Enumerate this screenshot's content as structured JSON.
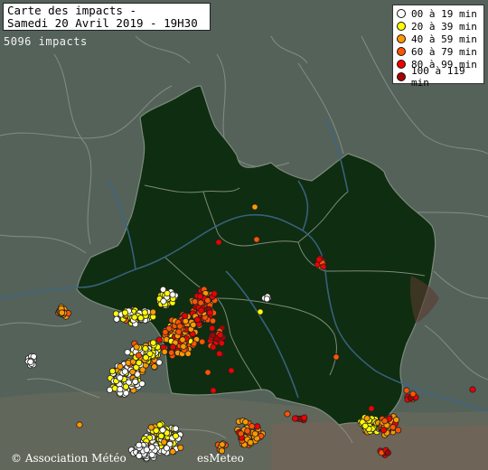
{
  "title": {
    "line1": "Carte des impacts -",
    "line2": "Samedi 20 Avril 2019 - 19H30"
  },
  "impact_count": "5096 impacts",
  "legend": [
    {
      "label": "00 à 19 min",
      "color": "#ffffff"
    },
    {
      "label": "20 à 39 min",
      "color": "#ffff00"
    },
    {
      "label": "40 à 59 min",
      "color": "#ff9900"
    },
    {
      "label": "60 à 79 min",
      "color": "#ff5500"
    },
    {
      "label": "80 à 99 min",
      "color": "#ee0000"
    },
    {
      "label": "100 à 119 min",
      "color": "#aa0000"
    }
  ],
  "credit": {
    "left": "© Association Météo",
    "right": "esMeteo"
  },
  "colors": {
    "background_land": "#55625a",
    "region_fill": "#0f2d10",
    "river": "#3d6688",
    "border": "#8e978f"
  }
}
